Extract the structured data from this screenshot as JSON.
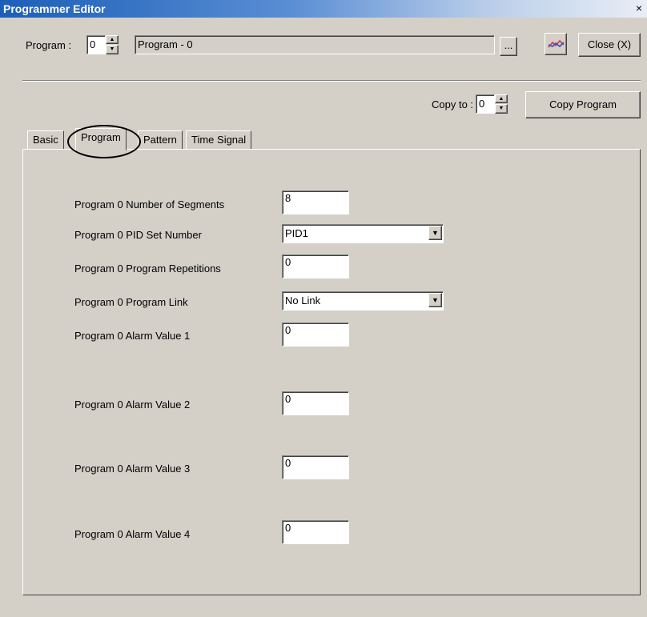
{
  "window": {
    "title": "Programmer Editor",
    "close_glyph": "×"
  },
  "header": {
    "program_label": "Program :",
    "program_number": "0",
    "program_name": "Program - 0",
    "browse_label": "...",
    "chart_icon": "trend-chart-icon",
    "close_label": "Close (X)"
  },
  "copy": {
    "copy_to_label": "Copy to :",
    "copy_to_value": "0",
    "copy_program_label": "Copy Program"
  },
  "tabs": [
    {
      "label": "Basic",
      "active": false
    },
    {
      "label": "Program",
      "active": true
    },
    {
      "label": "Pattern",
      "active": false
    },
    {
      "label": "Time Signal",
      "active": false
    }
  ],
  "settings": {
    "segments_label": "Program 0 Number of Segments",
    "segments_value": "8",
    "pid_label": "Program 0 PID Set Number",
    "pid_value": "PID1",
    "repetitions_label": "Program 0 Program Repetitions",
    "repetitions_value": "0",
    "link_label": "Program 0 Program Link",
    "link_value": "No Link",
    "alarm1_label": "Program 0 Alarm Value 1",
    "alarm1_value": "0",
    "alarm2_label": "Program 0 Alarm Value 2",
    "alarm2_value": "0",
    "alarm3_label": "Program 0 Alarm Value 3",
    "alarm3_value": "0",
    "alarm4_label": "Program 0 Alarm Value 4",
    "alarm4_value": "0"
  },
  "colors": {
    "titlebar_start": "#1c5fb8",
    "face": "#d4d0c8",
    "chart_line_red": "#e03030",
    "chart_line_blue": "#3050d0"
  }
}
